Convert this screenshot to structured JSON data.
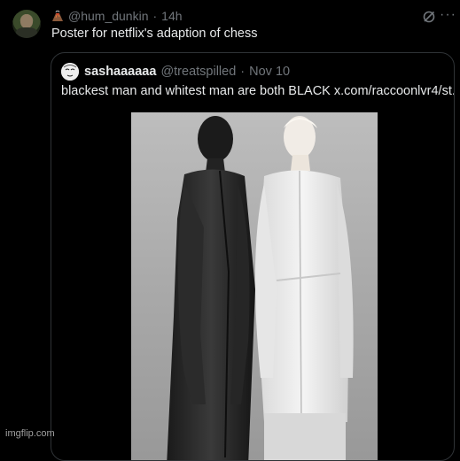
{
  "post": {
    "emoji_icon": "volcano-icon",
    "handle": "@hum_dunkin",
    "separator": "·",
    "time": "14h",
    "text": "Poster for netflix's adaption of chess",
    "more_label": "···"
  },
  "quoted": {
    "name": "sashaaaaaa",
    "handle": "@treatspilled",
    "separator": "·",
    "date": "Nov 10",
    "text": "blackest man and whitest man are both BLACK",
    "link": "x.com/raccoonlvr4/st..."
  },
  "watermark": "imgflip.com",
  "colors": {
    "background": "#000000",
    "text": "#e7e9ea",
    "muted": "#71767b",
    "border": "#2f3336"
  }
}
